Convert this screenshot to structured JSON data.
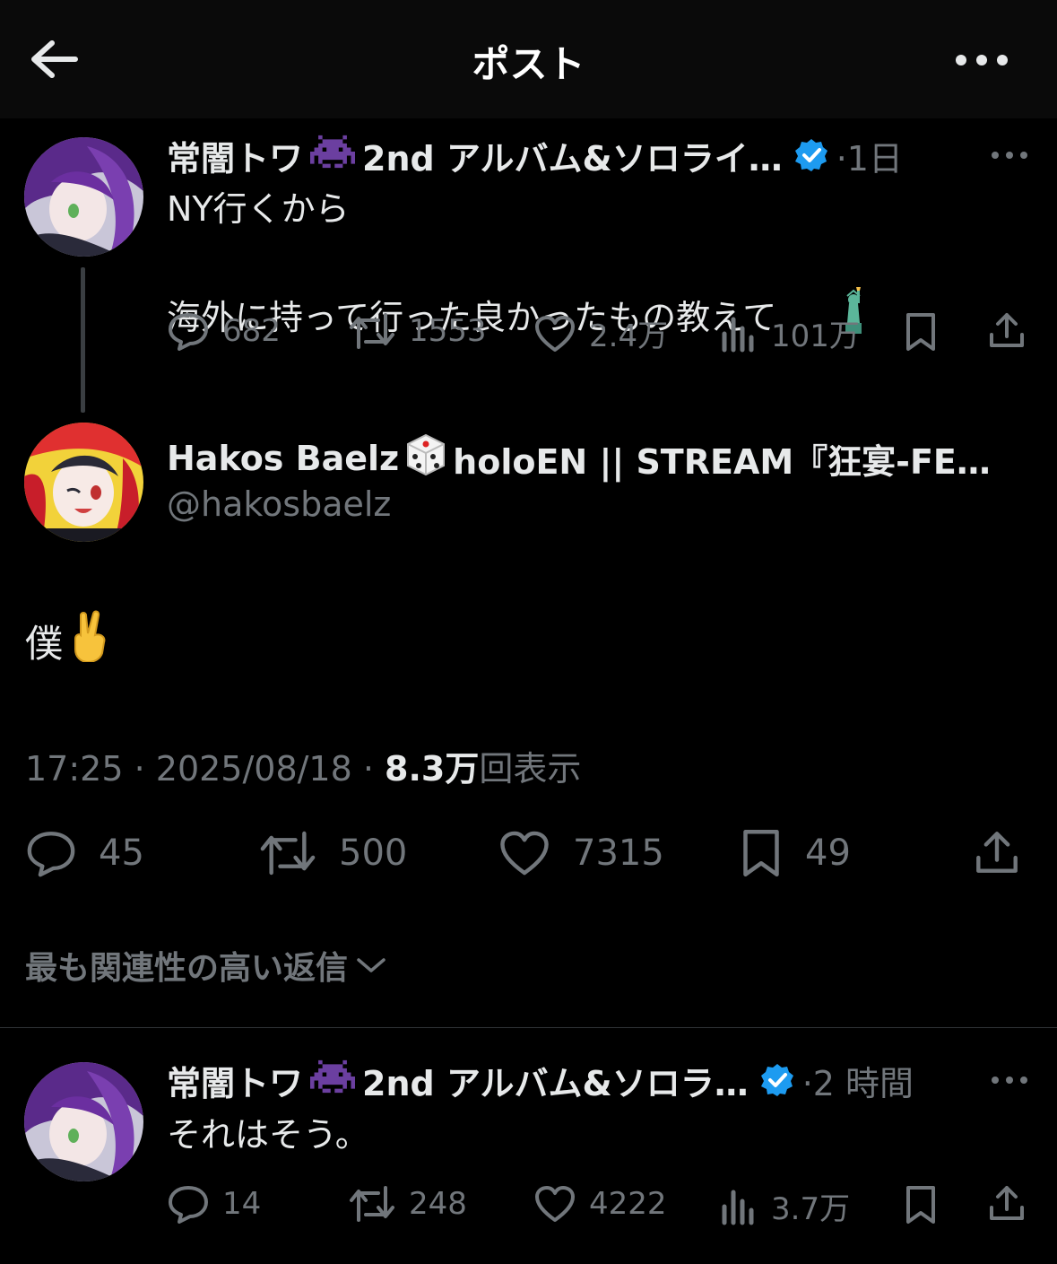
{
  "header": {
    "title": "ポスト"
  },
  "parent_tweet": {
    "name": "常闇トワ",
    "name_suffix": "2nd アルバム&ソロライ…",
    "time": "1日",
    "lines": [
      "NY行くから",
      "海外に持って行った良かったもの教えて"
    ],
    "replies": "682",
    "retweets": "1553",
    "likes": "2.4万",
    "views": "101万"
  },
  "main_tweet": {
    "name": "Hakos Baelz",
    "name_suffix": "holoEN || STREAM『狂宴-FE…",
    "handle": "@hakosbaelz",
    "text": "僕",
    "time": "17:25",
    "date": "2025/08/18",
    "views_count": "8.3万",
    "views_label": "回表示",
    "replies": "45",
    "retweets": "500",
    "likes": "7315",
    "bookmarks": "49"
  },
  "sort": {
    "label": "最も関連性の高い返信"
  },
  "reply_tweet": {
    "name": "常闇トワ",
    "name_suffix": "2nd アルバム&ソロラ…",
    "time": "2 時間",
    "text": "それはそう。",
    "replies": "14",
    "retweets": "248",
    "likes": "4222",
    "views": "3.7万"
  },
  "colors": {
    "background": "#000000",
    "text": "#e7e9ea",
    "muted": "#71767b",
    "verified": "#1d9bf0",
    "invader": "#6b3fa0"
  }
}
